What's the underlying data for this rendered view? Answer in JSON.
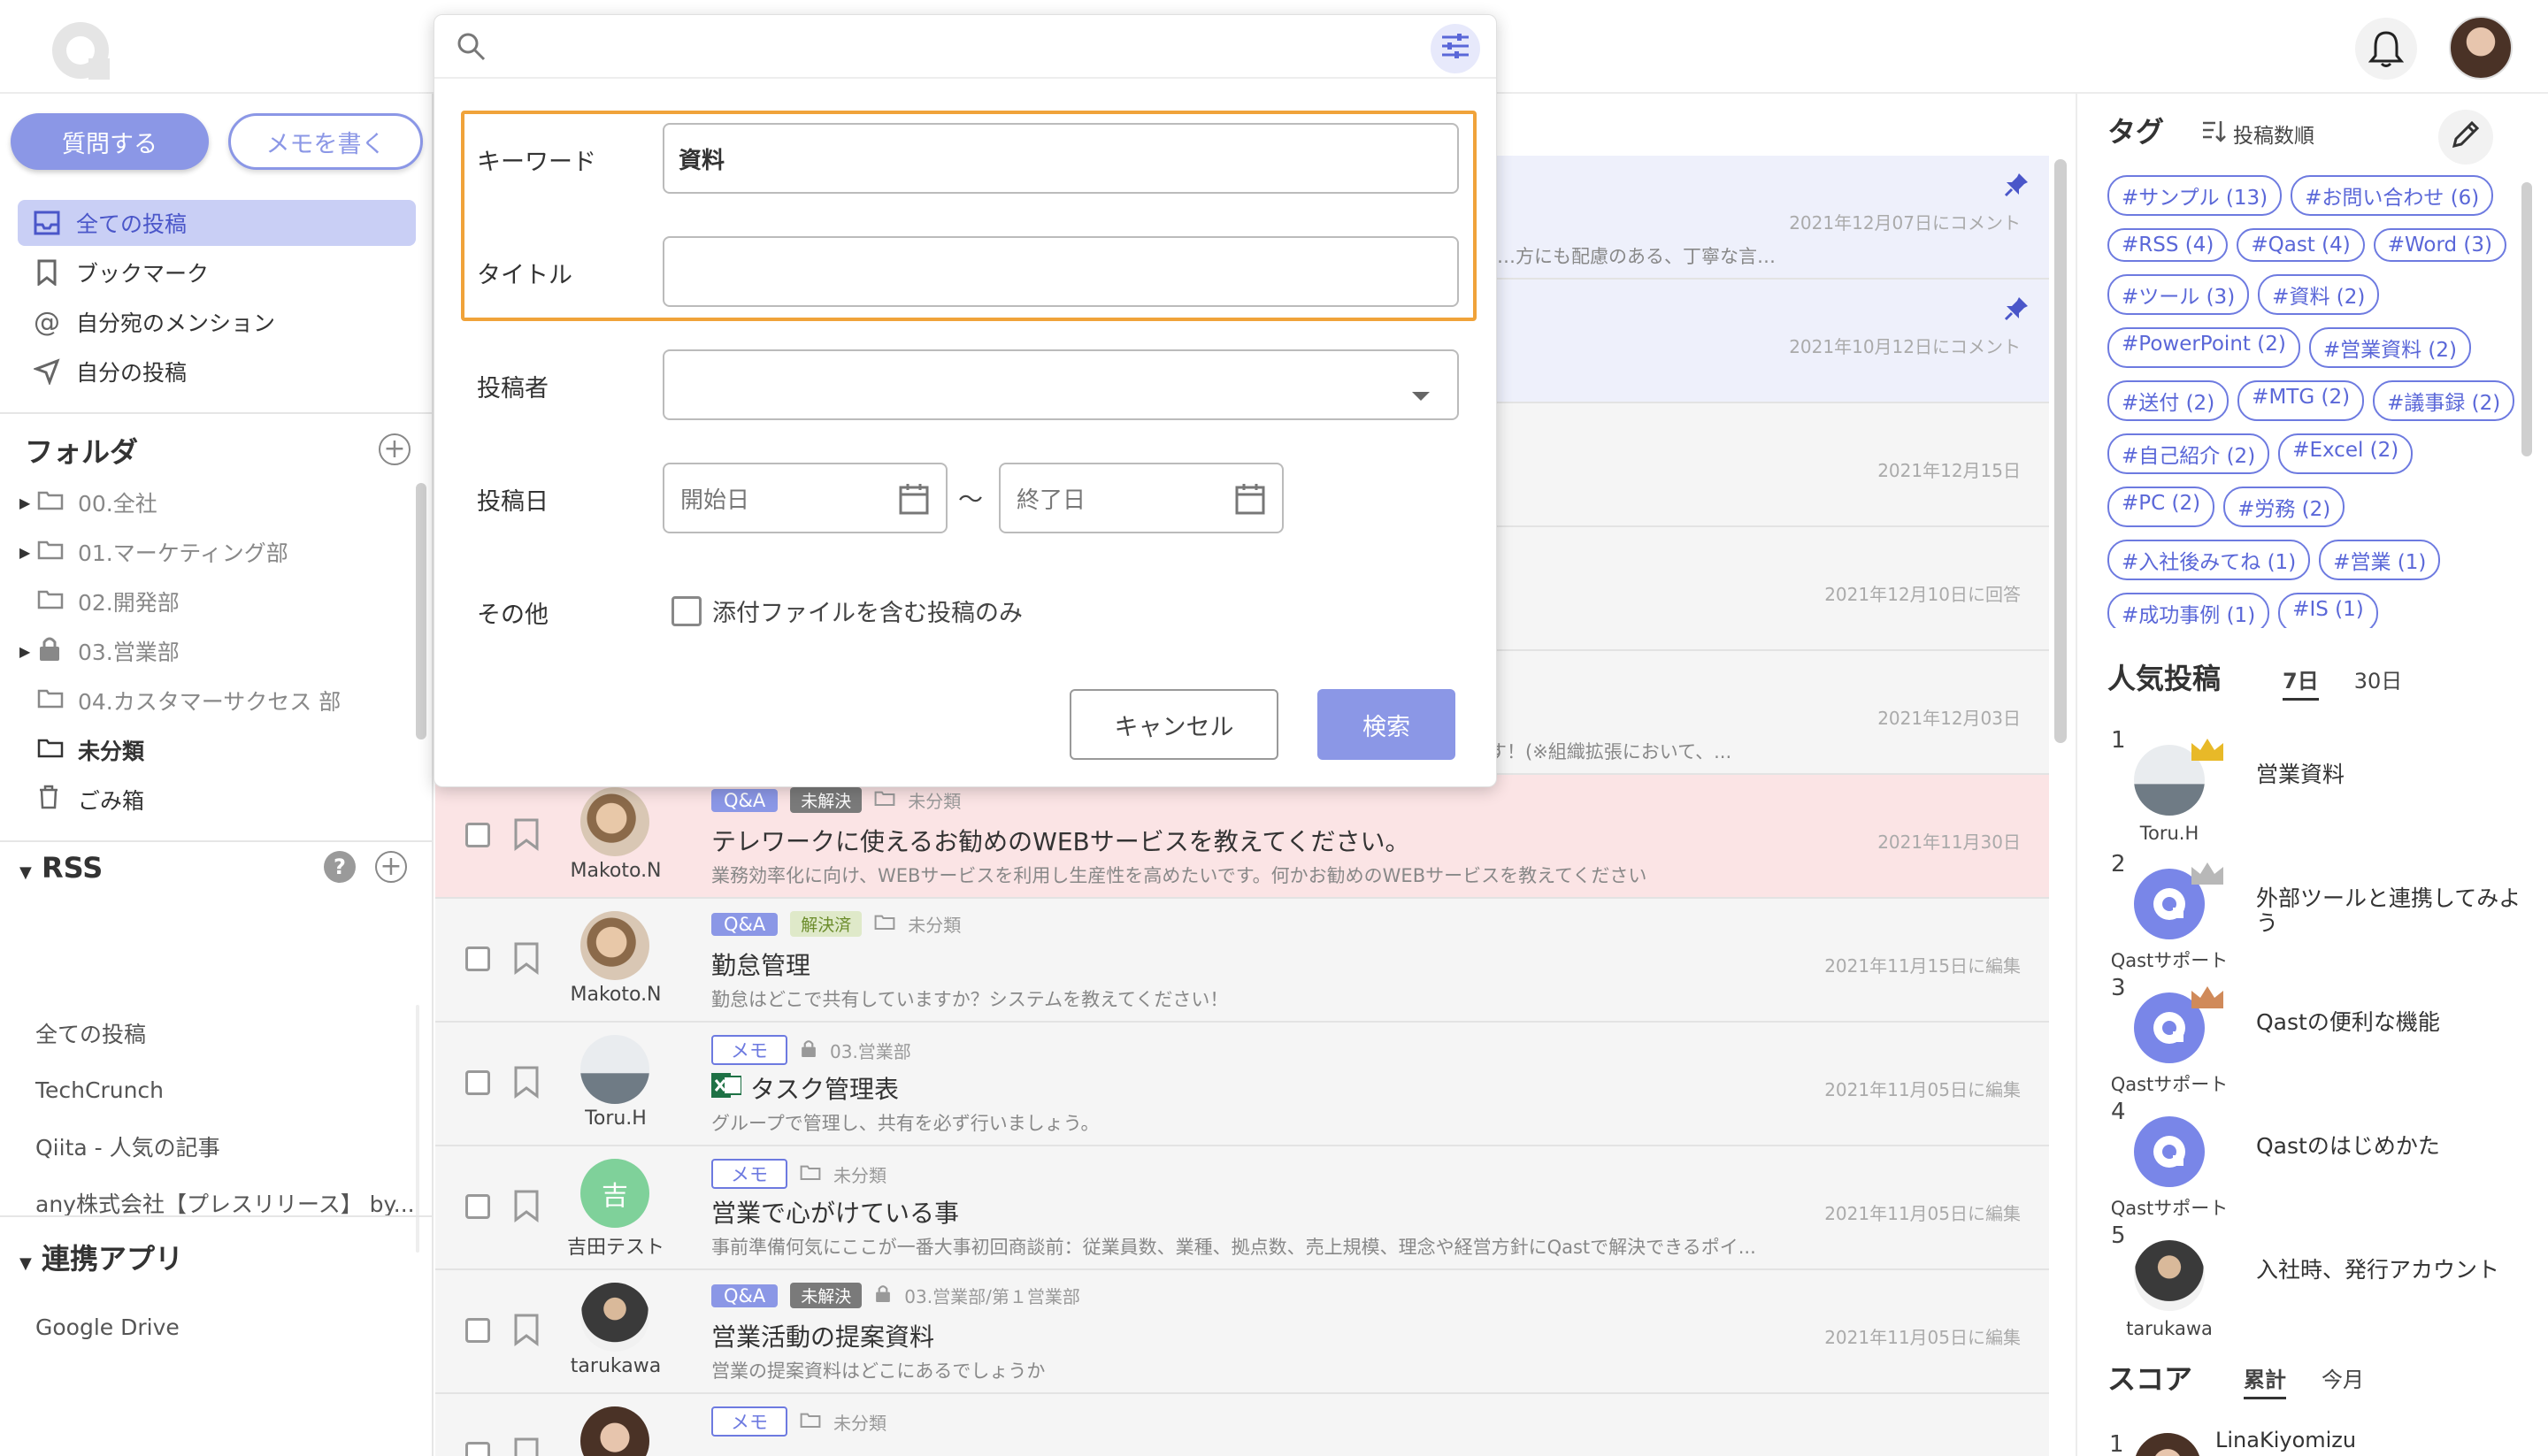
{
  "header": {
    "logo": "qast-logo",
    "bell": "bell-icon",
    "avatar": "user-avatar"
  },
  "sidebar": {
    "ask_label": "質問する",
    "memo_label": "メモを書く",
    "nav": [
      {
        "label": "全ての投稿",
        "icon": "inbox-icon"
      },
      {
        "label": "ブックマーク",
        "icon": "bookmark-icon"
      },
      {
        "label": "自分宛のメンション",
        "icon": "at-icon"
      },
      {
        "label": "自分の投稿",
        "icon": "send-icon"
      }
    ],
    "folder_heading": "フォルダ",
    "folders": [
      {
        "label": "00.全社",
        "arrow": true
      },
      {
        "label": "01.マーケティング部",
        "arrow": true
      },
      {
        "label": "02.開発部",
        "arrow": false
      },
      {
        "label": "03.営業部",
        "arrow": true,
        "locked": true
      },
      {
        "label": "04.カスタマーサクセス 部",
        "arrow": false
      }
    ],
    "uncategorized": "未分類",
    "trash": "ごみ箱",
    "rss_heading": "RSS",
    "rss_help": "?",
    "rss": [
      "全ての投稿",
      "TechCrunch",
      "Qiita - 人気の記事",
      "any株式会社【プレスリリース】 by..."
    ],
    "apps_heading": "連携アプリ",
    "apps": [
      "Google Drive"
    ]
  },
  "posts": [
    {
      "meta": "",
      "title": "",
      "sub": "…方にも配慮のある、丁寧な言…",
      "date": "2021年12月07日にコメント",
      "style": "pinned"
    },
    {
      "meta": "",
      "title": "",
      "sub": "",
      "date": "2021年10月12日にコメント",
      "style": "pinned"
    },
    {
      "meta": "",
      "title": "",
      "sub": "",
      "date": "2021年12月15日",
      "style": "plain"
    },
    {
      "meta": "",
      "title": "",
      "sub": "",
      "date": "2021年12月10日に回答",
      "style": "plain"
    },
    {
      "meta": "",
      "title": "",
      "sub": "す！(※組織拡張において、...",
      "date": "2021年12月03日",
      "style": "plain"
    },
    {
      "author": "Makoto.N",
      "type": "Q&A",
      "status": "未解決",
      "folder": "未分類",
      "title": "テレワークに使えるお勧めのWEBサービスを教えてください。",
      "sub": "業務効率化に向け、WEBサービスを利用し生産性を高めたいです。何かお勧めのWEBサービスを教えてください",
      "date": "2021年11月30日",
      "style": "pink"
    },
    {
      "author": "Makoto.N",
      "type": "Q&A",
      "status": "解決済",
      "folder": "未分類",
      "title": "勤怠管理",
      "sub": "勤怠はどこで共有していますか？システムを教えてください！",
      "date": "2021年11月15日に編集",
      "style": "plain"
    },
    {
      "author": "Toru.H",
      "type": "メモ",
      "folder": "03.営業部",
      "title": "タスク管理表",
      "sub": "グループで管理し、共有を必ず行いましょう。",
      "date": "2021年11月05日に編集",
      "style": "plain"
    },
    {
      "author": "吉田テスト",
      "avatar_char": "吉",
      "type": "メモ",
      "folder": "未分類",
      "title": "営業で心がけている事",
      "sub": "事前準備何気にここが一番大事初回商談前：従業員数、業種、拠点数、売上規模、理念や経営方針にQastで解決できるポイ...",
      "date": "2021年11月05日に編集",
      "style": "plain"
    },
    {
      "author": "tarukawa",
      "type": "Q&A",
      "status": "未解決",
      "folder": "03.営業部/第１営業部",
      "title": "営業活動の提案資料",
      "sub": "営業の提案資料はどこにあるでしょうか",
      "date": "2021年11月05日に編集",
      "style": "plain"
    },
    {
      "author": "",
      "type": "メモ",
      "folder": "未分類",
      "title": "",
      "sub": "",
      "date": "",
      "style": "plain"
    }
  ],
  "right": {
    "tag_heading": "タグ",
    "tag_sort": "投稿数順",
    "tags": [
      "#サンプル (13)",
      "#お問い合わせ (6)",
      "#RSS (4)",
      "#Qast (4)",
      "#Word (3)",
      "#ツール (3)",
      "#資料 (2)",
      "#PowerPoint (2)",
      "#営業資料 (2)",
      "#送付 (2)",
      "#MTG (2)",
      "#議事録 (2)",
      "#自己紹介 (2)",
      "#Excel (2)",
      "#PC (2)",
      "#労務 (2)",
      "#入社後みてね (1)",
      "#営業 (1)",
      "#成功事例 (1)",
      "#IS (1)"
    ],
    "popular_heading": "人気投稿",
    "popular_tabs": [
      "7日",
      "30日"
    ],
    "popular": [
      {
        "rank": "1",
        "name": "Toru.H",
        "title": "営業資料",
        "crown": "#e8b928"
      },
      {
        "rank": "2",
        "name": "Qastサポート",
        "title": "外部ツールと連携してみよう",
        "crown": "#b8b8b8"
      },
      {
        "rank": "3",
        "name": "Qastサポート",
        "title": "Qastの便利な機能",
        "crown": "#d08a5a"
      },
      {
        "rank": "4",
        "name": "Qastサポート",
        "title": "Qastのはじめかた"
      },
      {
        "rank": "5",
        "name": "tarukawa",
        "title": "入社時、発行アカウント"
      }
    ],
    "score_heading": "スコア",
    "score_tabs": [
      "累計",
      "今月"
    ],
    "score_first": {
      "rank": "1",
      "name": "LinaKiyomizu"
    }
  },
  "search_panel": {
    "placeholder": "",
    "keyword_label": "キーワード",
    "keyword_value": "資料",
    "title_label": "タイトル",
    "title_value": "",
    "author_label": "投稿者",
    "date_label": "投稿日",
    "start_placeholder": "開始日",
    "end_placeholder": "終了日",
    "tilde": "〜",
    "other_label": "その他",
    "attach_label": "添付ファイルを含む投稿のみ",
    "cancel_label": "キャンセル",
    "search_label": "検索"
  },
  "colors": {
    "accent": "#8b97e6",
    "highlight": "#f0a33a",
    "tag": "#5a67d8"
  }
}
